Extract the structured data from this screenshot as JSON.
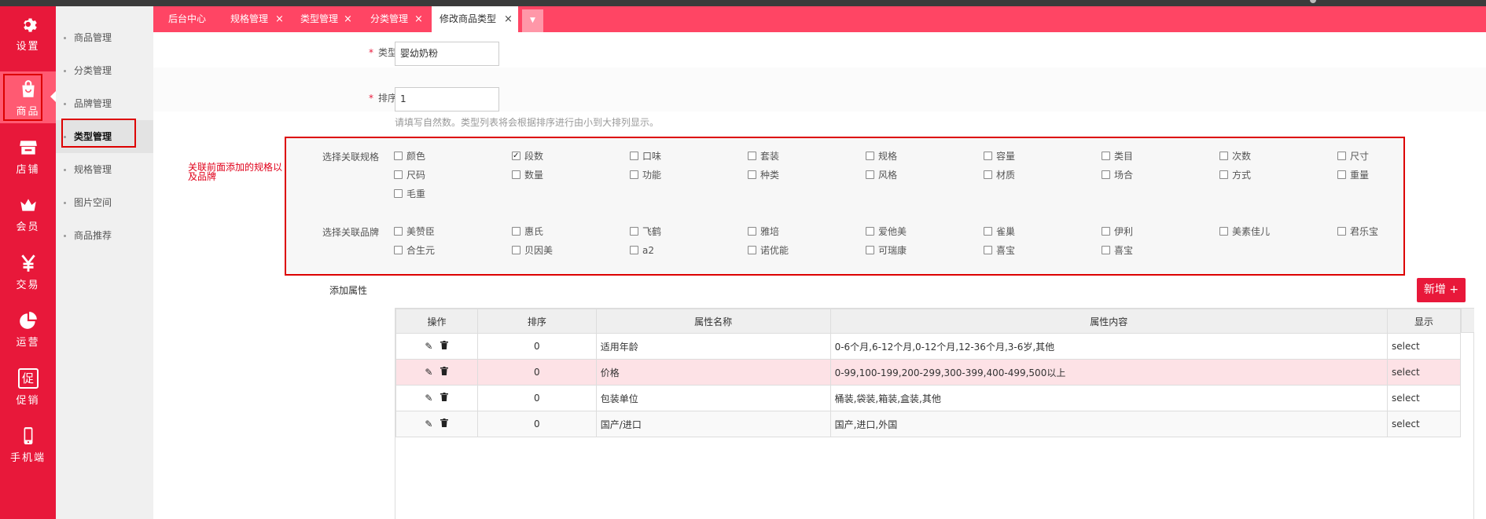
{
  "sidebar": {
    "items": [
      {
        "icon": "gear-icon",
        "label": "设置"
      },
      {
        "icon": "shopping-bag-icon",
        "label": "商品"
      },
      {
        "icon": "store-icon",
        "label": "店铺"
      },
      {
        "icon": "crown-icon",
        "label": "会员"
      },
      {
        "icon": "yen-icon",
        "label": "交易"
      },
      {
        "icon": "pie-chart-icon",
        "label": "运营"
      },
      {
        "icon": "promo-icon",
        "label": "促销"
      },
      {
        "icon": "mobile-icon",
        "label": "手机端"
      }
    ],
    "promo_glyph": "促"
  },
  "submenu": {
    "items": [
      "商品管理",
      "分类管理",
      "品牌管理",
      "类型管理",
      "规格管理",
      "图片空间",
      "商品推荐"
    ]
  },
  "tabs": {
    "items": [
      "后台中心",
      "规格管理",
      "类型管理",
      "分类管理",
      "修改商品类型"
    ],
    "close": "×",
    "more": "▼"
  },
  "form": {
    "type_label": "类型",
    "type_value": "婴幼奶粉",
    "sort_label": "排序",
    "sort_value": "1",
    "sort_hint": "请填写自然数。类型列表将会根据排序进行由小到大排列显示。",
    "required_mark": "*"
  },
  "annotation": "关联前面添加的规格以及品牌",
  "spec": {
    "label": "选择关联规格",
    "options": [
      {
        "name": "颜色",
        "checked": false
      },
      {
        "name": "段数",
        "checked": true
      },
      {
        "name": "口味",
        "checked": false
      },
      {
        "name": "套装",
        "checked": false
      },
      {
        "name": "规格",
        "checked": false
      },
      {
        "name": "容量",
        "checked": false
      },
      {
        "name": "类目",
        "checked": false
      },
      {
        "name": "次数",
        "checked": false
      },
      {
        "name": "尺寸",
        "checked": false
      },
      {
        "name": "尺码",
        "checked": false
      },
      {
        "name": "数量",
        "checked": false
      },
      {
        "name": "功能",
        "checked": false
      },
      {
        "name": "种类",
        "checked": false
      },
      {
        "name": "风格",
        "checked": false
      },
      {
        "name": "材质",
        "checked": false
      },
      {
        "name": "场合",
        "checked": false
      },
      {
        "name": "方式",
        "checked": false
      },
      {
        "name": "重量",
        "checked": false
      },
      {
        "name": "毛重",
        "checked": false
      }
    ]
  },
  "brand": {
    "label": "选择关联品牌",
    "options": [
      {
        "name": "美赞臣",
        "checked": false
      },
      {
        "name": "惠氏",
        "checked": false
      },
      {
        "name": "飞鹤",
        "checked": false
      },
      {
        "name": "雅培",
        "checked": false
      },
      {
        "name": "爱他美",
        "checked": false
      },
      {
        "name": "雀巢",
        "checked": false
      },
      {
        "name": "伊利",
        "checked": false
      },
      {
        "name": "美素佳儿",
        "checked": false
      },
      {
        "name": "君乐宝",
        "checked": false
      },
      {
        "name": "合生元",
        "checked": false
      },
      {
        "name": "贝因美",
        "checked": false
      },
      {
        "name": "a2",
        "checked": false
      },
      {
        "name": "诺优能",
        "checked": false
      },
      {
        "name": "可瑞康",
        "checked": false
      },
      {
        "name": "喜宝",
        "checked": false
      },
      {
        "name": "喜宝",
        "checked": false
      }
    ]
  },
  "attributes": {
    "add_label": "添加属性",
    "new_button": "新增 +",
    "columns": [
      "操作",
      "排序",
      "属性名称",
      "属性内容",
      "显示"
    ],
    "rows": [
      {
        "sort": "0",
        "name": "适用年龄",
        "content": "0-6个月,6-12个月,0-12个月,12-36个月,3-6岁,其他",
        "show": "select",
        "highlight": false
      },
      {
        "sort": "0",
        "name": "价格",
        "content": "0-99,100-199,200-299,300-399,400-499,500以上",
        "show": "select",
        "highlight": true
      },
      {
        "sort": "0",
        "name": "包装单位",
        "content": "桶装,袋装,箱装,盒装,其他",
        "show": "select",
        "highlight": false
      },
      {
        "sort": "0",
        "name": "国产/进口",
        "content": "国产,进口,外国",
        "show": "select",
        "highlight": false
      }
    ],
    "edit_icon": "✎",
    "delete_icon": "🗑"
  },
  "colors": {
    "sidebar_red": "#e8183a",
    "tab_pink": "#ff4564",
    "highlight_row": "#fde2e6",
    "annotation_red": "#d00"
  }
}
